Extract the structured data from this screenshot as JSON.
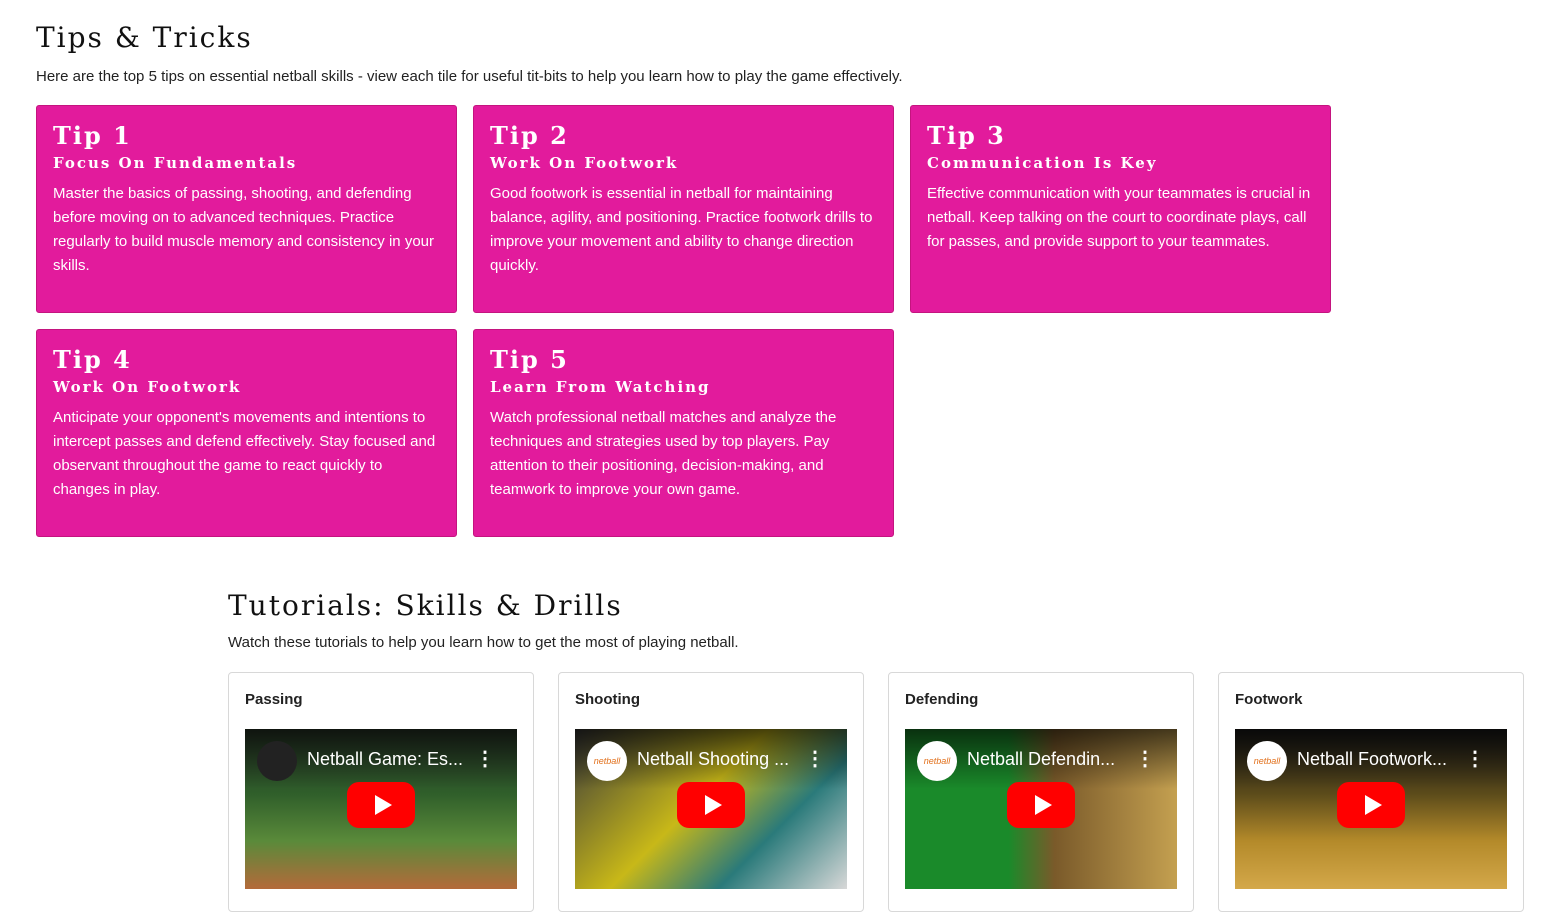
{
  "tips": {
    "title": "Tips & Tricks",
    "intro": "Here are the top 5 tips on essential netball skills - view each tile for useful tit-bits to help you learn how to play the game effectively.",
    "accent_color": "#e21b9c",
    "cards": [
      {
        "title": "Tip 1",
        "subtitle": "Focus On Fundamentals",
        "body": "Master the basics of passing, shooting, and defending before moving on to advanced techniques. Practice regularly to build muscle memory and consistency in your skills."
      },
      {
        "title": "Tip 2",
        "subtitle": "Work On Footwork",
        "body": "Good footwork is essential in netball for maintaining balance, agility, and positioning. Practice footwork drills to improve your movement and ability to change direction quickly."
      },
      {
        "title": "Tip 3",
        "subtitle": "Communication Is Key",
        "body": "Effective communication with your teammates is crucial in netball. Keep talking on the court to coordinate plays, call for passes, and provide support to your teammates."
      },
      {
        "title": "Tip 4",
        "subtitle": "Work On Footwork",
        "body": "Anticipate your opponent's movements and intentions to intercept passes and defend effectively. Stay focused and observant throughout the game to react quickly to changes in play."
      },
      {
        "title": "Tip 5",
        "subtitle": "Learn From Watching",
        "body": "Watch professional netball matches and analyze the techniques and strategies used by top players. Pay attention to their positioning, decision-making, and teamwork to improve your own game."
      }
    ]
  },
  "tutorials": {
    "title": "Tutorials: Skills & Drills",
    "intro": "Watch these tutorials to help you learn how to get the most of playing netball.",
    "videos": [
      {
        "label": "Passing",
        "video_title": "Netball Game: Es...",
        "channel_logo": "",
        "play_color": "#ff0000"
      },
      {
        "label": "Shooting",
        "video_title": "Netball Shooting ...",
        "channel_logo": "netball",
        "play_color": "#ff0000"
      },
      {
        "label": "Defending",
        "video_title": "Netball Defendin...",
        "channel_logo": "netball",
        "play_color": "#ff0000"
      },
      {
        "label": "Footwork",
        "video_title": "Netball Footwork...",
        "channel_logo": "netball",
        "play_color": "#ff0000"
      }
    ]
  }
}
